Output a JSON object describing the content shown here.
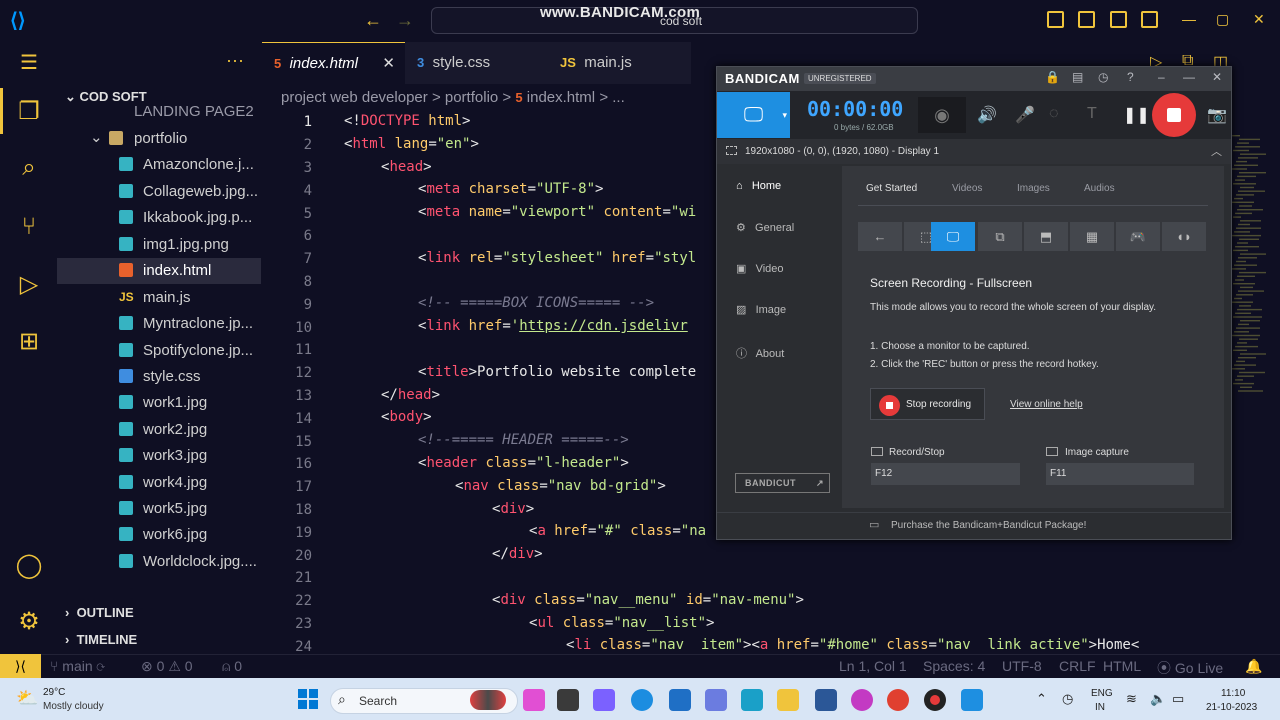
{
  "watermark": {
    "brand": "www.BANDICAM.com",
    "sub": "cod soft"
  },
  "sidebar": {
    "section": "COD SOFT",
    "items": [
      {
        "label": "LANDING PAGE2",
        "type": "folder-partial"
      },
      {
        "label": "portfolio",
        "type": "folder"
      },
      {
        "label": "Amazonclone.j...",
        "type": "img"
      },
      {
        "label": "Collageweb.jpg...",
        "type": "img"
      },
      {
        "label": "Ikkabook.jpg.p...",
        "type": "img"
      },
      {
        "label": "img1.jpg.png",
        "type": "img"
      },
      {
        "label": "index.html",
        "type": "html"
      },
      {
        "label": "main.js",
        "type": "js"
      },
      {
        "label": "Myntraclone.jp...",
        "type": "img"
      },
      {
        "label": "Spotifyclone.jp...",
        "type": "img"
      },
      {
        "label": "style.css",
        "type": "css"
      },
      {
        "label": "work1.jpg",
        "type": "img"
      },
      {
        "label": "work2.jpg",
        "type": "img"
      },
      {
        "label": "work3.jpg",
        "type": "img"
      },
      {
        "label": "work4.jpg",
        "type": "img"
      },
      {
        "label": "work5.jpg",
        "type": "img"
      },
      {
        "label": "work6.jpg",
        "type": "img"
      },
      {
        "label": "Worldclock.jpg....",
        "type": "img"
      }
    ],
    "outline": "OUTLINE",
    "timeline": "TIMELINE"
  },
  "tabs": [
    {
      "label": "index.html",
      "icon": "html-icon"
    },
    {
      "label": "style.css",
      "icon": "css-icon"
    },
    {
      "label": "main.js",
      "icon": "js-icon"
    }
  ],
  "breadcrumb": [
    "project web developer",
    ">",
    "portfolio",
    ">",
    "index.html",
    ">",
    "..."
  ],
  "editor": {
    "line_numbers": [
      "1",
      "2",
      "3",
      "4",
      "5",
      "6",
      "7",
      "8",
      "9",
      "10",
      "11",
      "12",
      "13",
      "14",
      "15",
      "16",
      "17",
      "18",
      "19",
      "20",
      "21",
      "22",
      "23",
      "24"
    ]
  },
  "bandicam": {
    "logo": "BANDICAM",
    "unregistered": "UNREGISTERED",
    "timer": "00:00:00",
    "size": "0 bytes / 62.0GB",
    "display": "1920x1080 - (0, 0), (1920, 1080) - Display 1",
    "nav": [
      "Home",
      "General",
      "Video",
      "Image",
      "About"
    ],
    "tabs": [
      "Get Started",
      "Videos",
      "Images",
      "Audios"
    ],
    "mode_title": "Screen Recording - Fullscreen",
    "mode_desc": "This mode allows you to record the whole screen of your display.",
    "step1": "1. Choose a monitor to be captured.",
    "step2": "2. Click the 'REC' button or press the record hotkey.",
    "stop_label": "Stop recording",
    "help_link": "View online help",
    "hotkey1_label": "Record/Stop",
    "hotkey1_value": "F12",
    "hotkey2_label": "Image capture",
    "hotkey2_value": "F11",
    "bandicut": "BANDICUT",
    "footer": "Purchase the Bandicam+Bandicut Package!"
  },
  "status": {
    "branch": "main",
    "errors": "0",
    "warnings": "0",
    "ports": "0",
    "position": "Ln 1, Col 1",
    "spaces": "Spaces: 4",
    "encoding": "UTF-8",
    "eol": "CRLF",
    "language": "HTML",
    "golive": "Go Live"
  },
  "taskbar": {
    "temp": "29°C",
    "weather": "Mostly cloudy",
    "search": "Search",
    "lang1": "ENG",
    "lang2": "IN",
    "time": "11:10",
    "date": "21-10-2023"
  },
  "colors": {
    "accent": "#f0c43c",
    "bandicam_blue": "#1e8fe1",
    "rec_red": "#e63a3a"
  }
}
